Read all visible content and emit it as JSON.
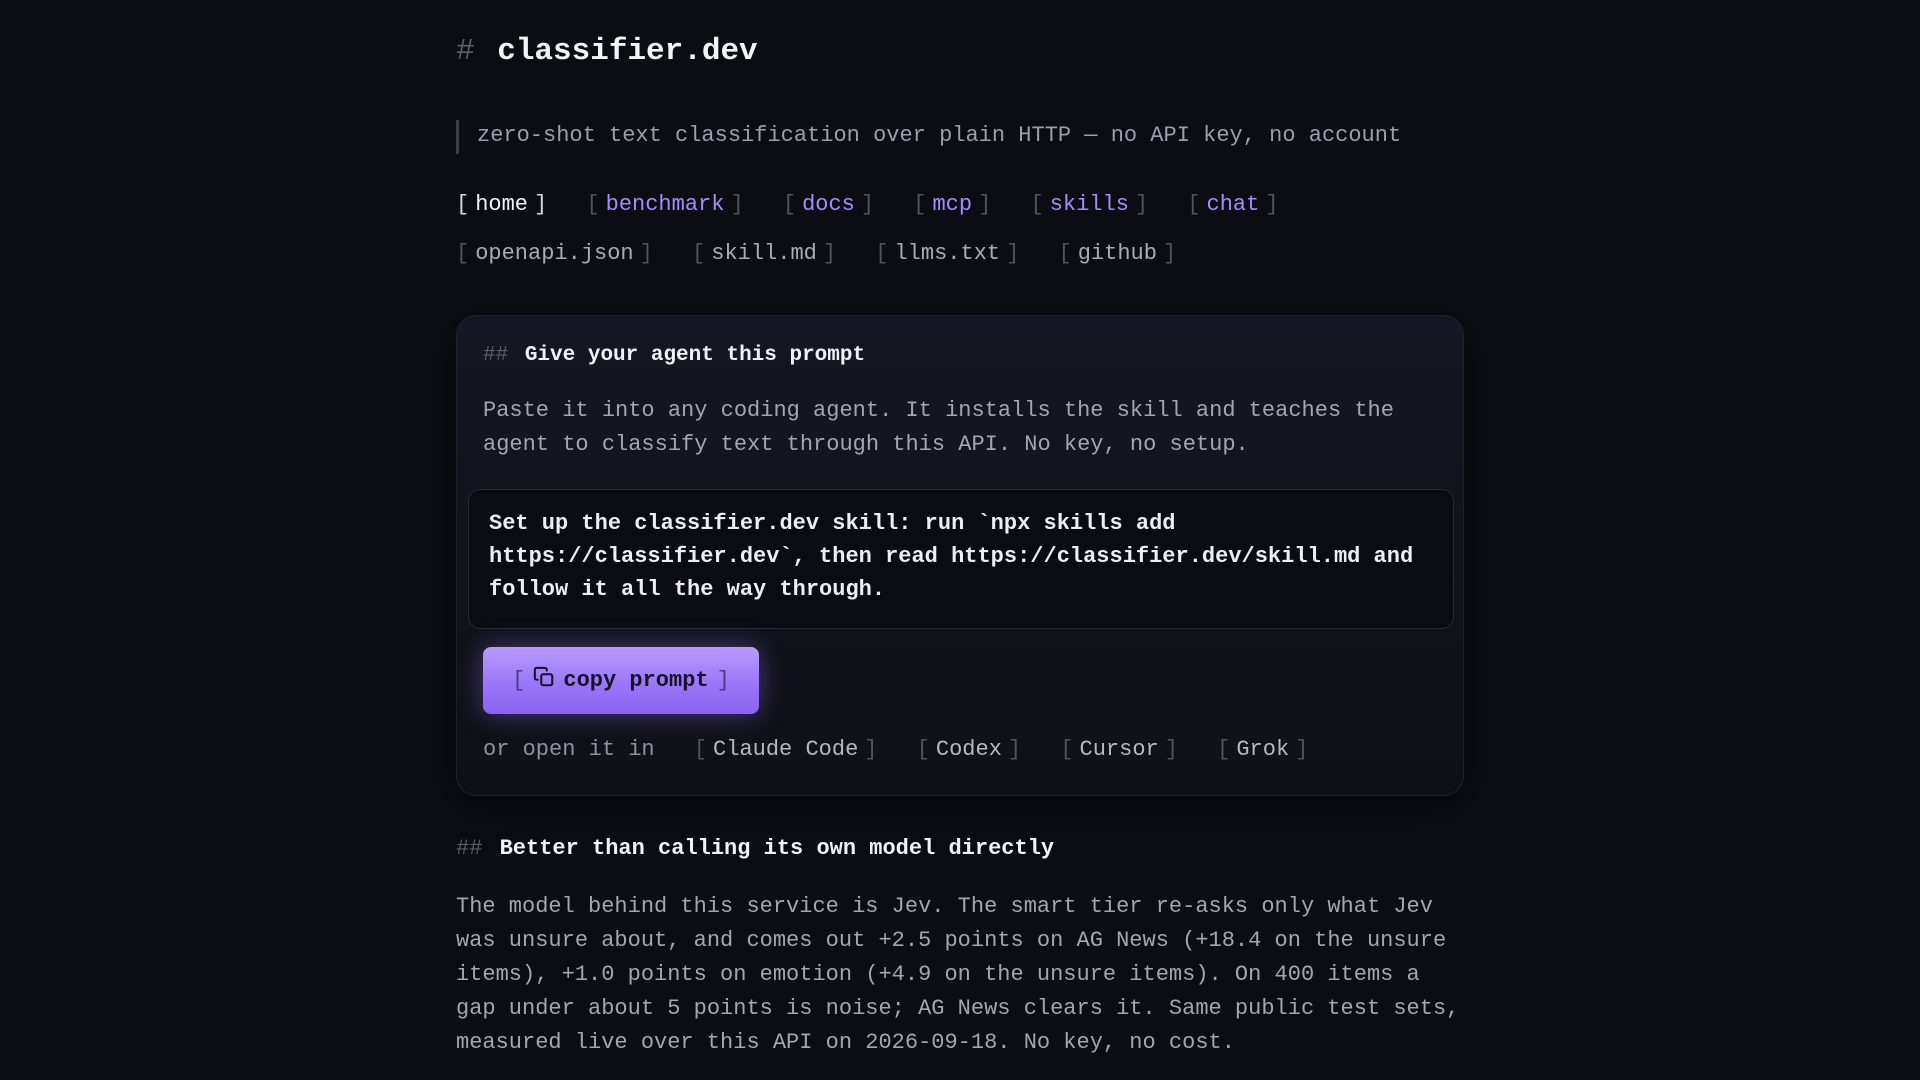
{
  "site": {
    "title_hash": "#",
    "title": "classifier.dev",
    "tagline": "zero-shot text classification over plain HTTP — no API key, no account"
  },
  "nav": {
    "primary": [
      {
        "label": "home",
        "style": "active"
      },
      {
        "label": "benchmark",
        "style": "purple"
      },
      {
        "label": "docs",
        "style": "purple"
      },
      {
        "label": "mcp",
        "style": "purple"
      },
      {
        "label": "skills",
        "style": "purple"
      },
      {
        "label": "chat",
        "style": "purple"
      }
    ],
    "secondary": [
      {
        "label": "openapi.json"
      },
      {
        "label": "skill.md"
      },
      {
        "label": "llms.txt"
      },
      {
        "label": "github"
      }
    ],
    "bracket_open": "[",
    "bracket_close": "]"
  },
  "prompt_card": {
    "heading_hash": "##",
    "heading": "Give your agent this prompt",
    "description": "Paste it into any coding agent. It installs the skill and teaches the agent to classify text through this API. No key, no setup.",
    "prompt_lines": [
      "Set up the classifier.dev skill: run `npx skills add",
      "https://classifier.dev`, then read https://classifier.dev/skill.md and",
      "follow it all the way through."
    ],
    "copy_button": {
      "label": "copy prompt",
      "icon": "copy-icon"
    },
    "open_in": {
      "lead": "or open it in",
      "targets": [
        "Claude Code",
        "Codex",
        "Cursor",
        "Grok"
      ]
    }
  },
  "comparison": {
    "heading_hash": "##",
    "heading": "Better than calling its own model directly",
    "body": "The model behind this service is Jev. The smart tier re-asks only what Jev was unsure about, and comes out +2.5 points on AG News (+18.4 on the unsure items), +1.0 points on emotion (+4.9 on the unsure items). On 400 items a gap under about 5 points is noise; AG News clears it. Same public test sets, measured live over this API on 2026-09-18. No key, no cost."
  },
  "colors": {
    "background": "#0b0d13",
    "accent": "#a78bfa",
    "button_gradient_top": "#b79cff",
    "button_gradient_bottom": "#8a62f1"
  }
}
